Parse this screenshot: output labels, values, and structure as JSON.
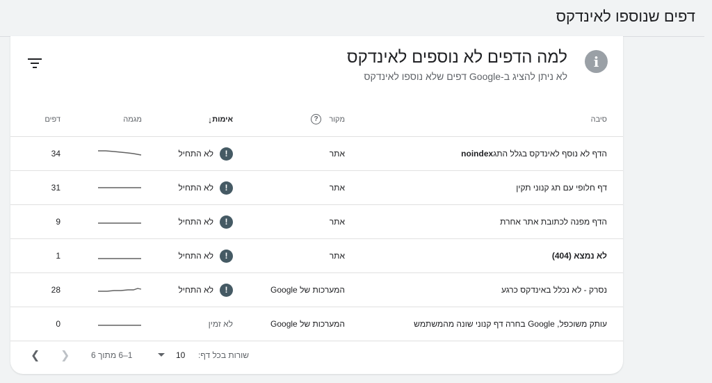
{
  "header": {
    "title": "דפים שנוספו לאינדקס"
  },
  "card": {
    "title": "למה הדפים לא נוספים לאינדקס",
    "subtitle": "לא ניתן להציג ב-Google דפים שלא נוספו לאינדקס",
    "info_icon": "info-icon",
    "filter_icon": "filter-icon"
  },
  "table": {
    "columns": {
      "reason": "סיבה",
      "source": "מקור",
      "validation": "אימות",
      "trend": "מגמה",
      "pages": "דפים"
    },
    "rows": [
      {
        "reason_prefix": "הדף לא נוסף לאינדקס בגלל התג ",
        "reason_bold": "noindex",
        "source": "אתר",
        "validation": "לא התחיל",
        "pages": "34"
      },
      {
        "reason_prefix": "דף חלופי עם תג קנוני תקין",
        "reason_bold": "",
        "source": "אתר",
        "validation": "לא התחיל",
        "pages": "31"
      },
      {
        "reason_prefix": "הדף מפנה לכתובת אתר אחרת",
        "reason_bold": "",
        "source": "אתר",
        "validation": "לא התחיל",
        "pages": "9"
      },
      {
        "reason_prefix": "לא נמצא (404)",
        "reason_bold": "",
        "source": "אתר",
        "validation": "לא התחיל",
        "pages": "1"
      },
      {
        "reason_prefix": "נסרק - לא נכלל באינדקס כרגע",
        "reason_bold": "",
        "source": "המערכות של Google",
        "validation": "לא התחיל",
        "pages": "28"
      },
      {
        "reason_prefix": "עותק משוכפל, Google בחרה דף קנוני שונה מהמשתמש",
        "reason_bold": "",
        "source": "המערכות של Google",
        "validation": "לא זמין",
        "pages": "0"
      }
    ]
  },
  "footer": {
    "rows_per_page_label": "שורות בכל דף:",
    "rows_per_page_value": "10",
    "range": "1–6 מתוך 6"
  },
  "colors": {
    "warning": "#455a64",
    "info": "#9aa0a6",
    "divider": "#e0e0e0"
  }
}
